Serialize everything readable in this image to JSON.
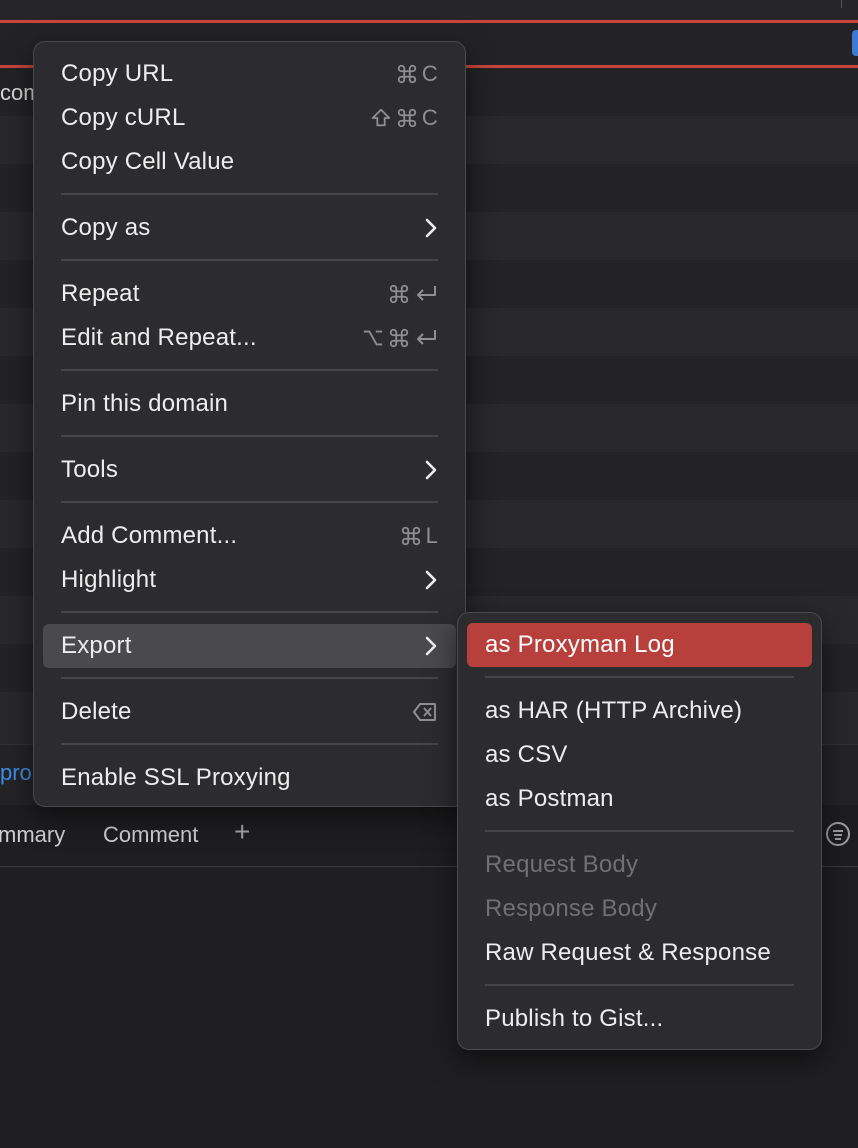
{
  "background": {
    "partial_left_text": "com",
    "url_fragment": "pro",
    "tabs": [
      "mmary",
      "Comment"
    ],
    "add_tab_symbol": "+"
  },
  "context_menu": {
    "items": {
      "copy_url": {
        "label": "Copy URL",
        "shortcut_key": "C"
      },
      "copy_curl": {
        "label": "Copy cURL",
        "shortcut_key": "C"
      },
      "copy_cell_value": {
        "label": "Copy Cell Value"
      },
      "copy_as": {
        "label": "Copy as"
      },
      "repeat": {
        "label": "Repeat"
      },
      "edit_and_repeat": {
        "label": "Edit and Repeat..."
      },
      "pin_domain": {
        "label": "Pin this domain"
      },
      "tools": {
        "label": "Tools"
      },
      "add_comment": {
        "label": "Add Comment...",
        "shortcut_key": "L"
      },
      "highlight": {
        "label": "Highlight"
      },
      "export": {
        "label": "Export"
      },
      "delete": {
        "label": "Delete"
      },
      "enable_ssl": {
        "label": "Enable SSL Proxying"
      }
    }
  },
  "export_submenu": {
    "proxyman_log": "as Proxyman Log",
    "har": "as HAR (HTTP Archive)",
    "csv": "as CSV",
    "postman": "as Postman",
    "request_body": "Request Body",
    "response_body": "Response Body",
    "raw": "Raw Request & Response",
    "gist": "Publish to Gist..."
  },
  "colors": {
    "menu_bg": "#2c2c2e",
    "highlight_red": "#b8403c",
    "hover_gray": "#4a4a4d",
    "link_blue": "#3d8fe8",
    "accent_red_line": "#c9443d"
  },
  "icons": {
    "command": "command-icon",
    "shift": "shift-icon",
    "option": "option-icon",
    "return": "return-icon",
    "delete": "delete-backward-icon",
    "submenu": "chevron-right-icon",
    "filter": "filter-icon"
  }
}
